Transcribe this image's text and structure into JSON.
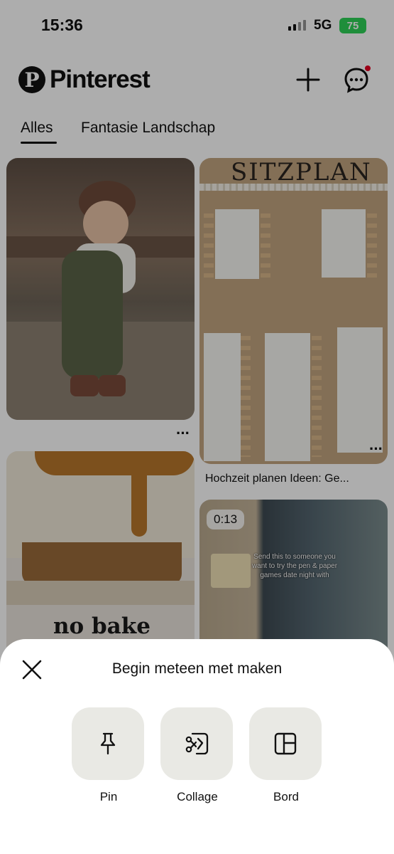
{
  "status_bar": {
    "time": "15:36",
    "network": "5G",
    "battery": "75"
  },
  "header": {
    "logo_text": "Pinterest",
    "icons": [
      "plus-icon",
      "chat-icon"
    ],
    "notification_color": "#e60023"
  },
  "tabs": [
    {
      "label": "Alles",
      "active": true
    },
    {
      "label": "Fantasie Landschap",
      "active": false
    }
  ],
  "feed": {
    "card_plan": {
      "sign_text": "SITZPLAN",
      "caption": "Hochzeit planen Ideen: Ge..."
    },
    "card_cake": {
      "title": "no bake"
    },
    "card_video": {
      "duration": "0:13",
      "caption": "Send this to someone you want to try the pen & paper games date night with"
    },
    "more_label": "···"
  },
  "sheet": {
    "title": "Begin meteen met maken",
    "options": [
      {
        "label": "Pin",
        "icon": "pushpin-icon"
      },
      {
        "label": "Collage",
        "icon": "collage-scissors-icon"
      },
      {
        "label": "Bord",
        "icon": "board-layout-icon"
      }
    ]
  },
  "colors": {
    "overlay": "rgba(0,0,0,0.32)",
    "tile_bg": "#e9e9e4",
    "battery": "#2fd158"
  }
}
